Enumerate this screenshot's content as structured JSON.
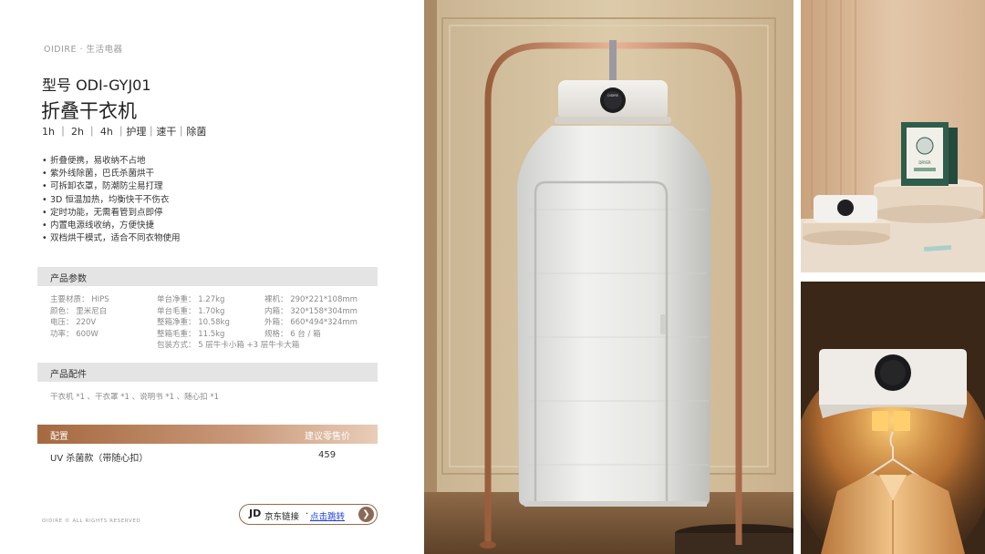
{
  "header": {
    "brand": "OIDIRE · 生活电器",
    "model": "型号 ODI-GYJ01",
    "title": "折叠干衣机",
    "modes": "1h ｜ 2h ｜ 4h ｜护理｜速干｜除菌"
  },
  "features": [
    "折叠便携，易收纳不占地",
    "紫外线除菌，巴氏杀菌烘干",
    "可拆卸衣罩，防潮防尘易打理",
    "3D 恒温加热，均衡快干不伤衣",
    "定时功能，无需看管到点即停",
    "内置电源线收纳，方便快捷",
    "双档烘干模式，适合不同衣物使用"
  ],
  "params": {
    "section_title": "产品参数",
    "col1": [
      "主要材质： HIPS",
      "颜色： 里米尼白",
      "电压： 220V",
      "功率： 600W"
    ],
    "col2": [
      "单台净重： 1.27kg",
      "单台毛重： 1.70kg",
      "整箱净重： 10.58kg",
      "整箱毛重： 11.5kg",
      "包装方式： 5 层牛卡小箱 +3 层牛卡大箱"
    ],
    "col3": [
      "裸机： 290*221*108mm",
      "内箱： 320*158*304mm",
      "外箱： 660*494*324mm",
      "规格： 6 台 / 箱"
    ]
  },
  "accessories": {
    "section_title": "产品配件",
    "text": "干衣机 *1 、干衣罩 *1 、说明书 *1 、随心扣 *1"
  },
  "pricing": {
    "col_config": "配置",
    "col_price": "建议零售价",
    "rows": [
      {
        "name": "UV 杀菌款（带随心扣）",
        "price": "459"
      }
    ]
  },
  "footer": {
    "copyright": "OIDIRE © ALL RIGHTS RESERVED",
    "jd_logo": "JD",
    "jd_text": "京东链接",
    "jd_sep": "·",
    "jd_link": "点击跳转",
    "arrow_icon": "chevron-right-icon"
  },
  "photos": {
    "device_brand": "OIDIRE",
    "box_label": "DRYER"
  },
  "colors": {
    "accent_brown": "#a5693f",
    "link_blue": "#1a3fd8",
    "section_gray": "#e4e4e4"
  }
}
